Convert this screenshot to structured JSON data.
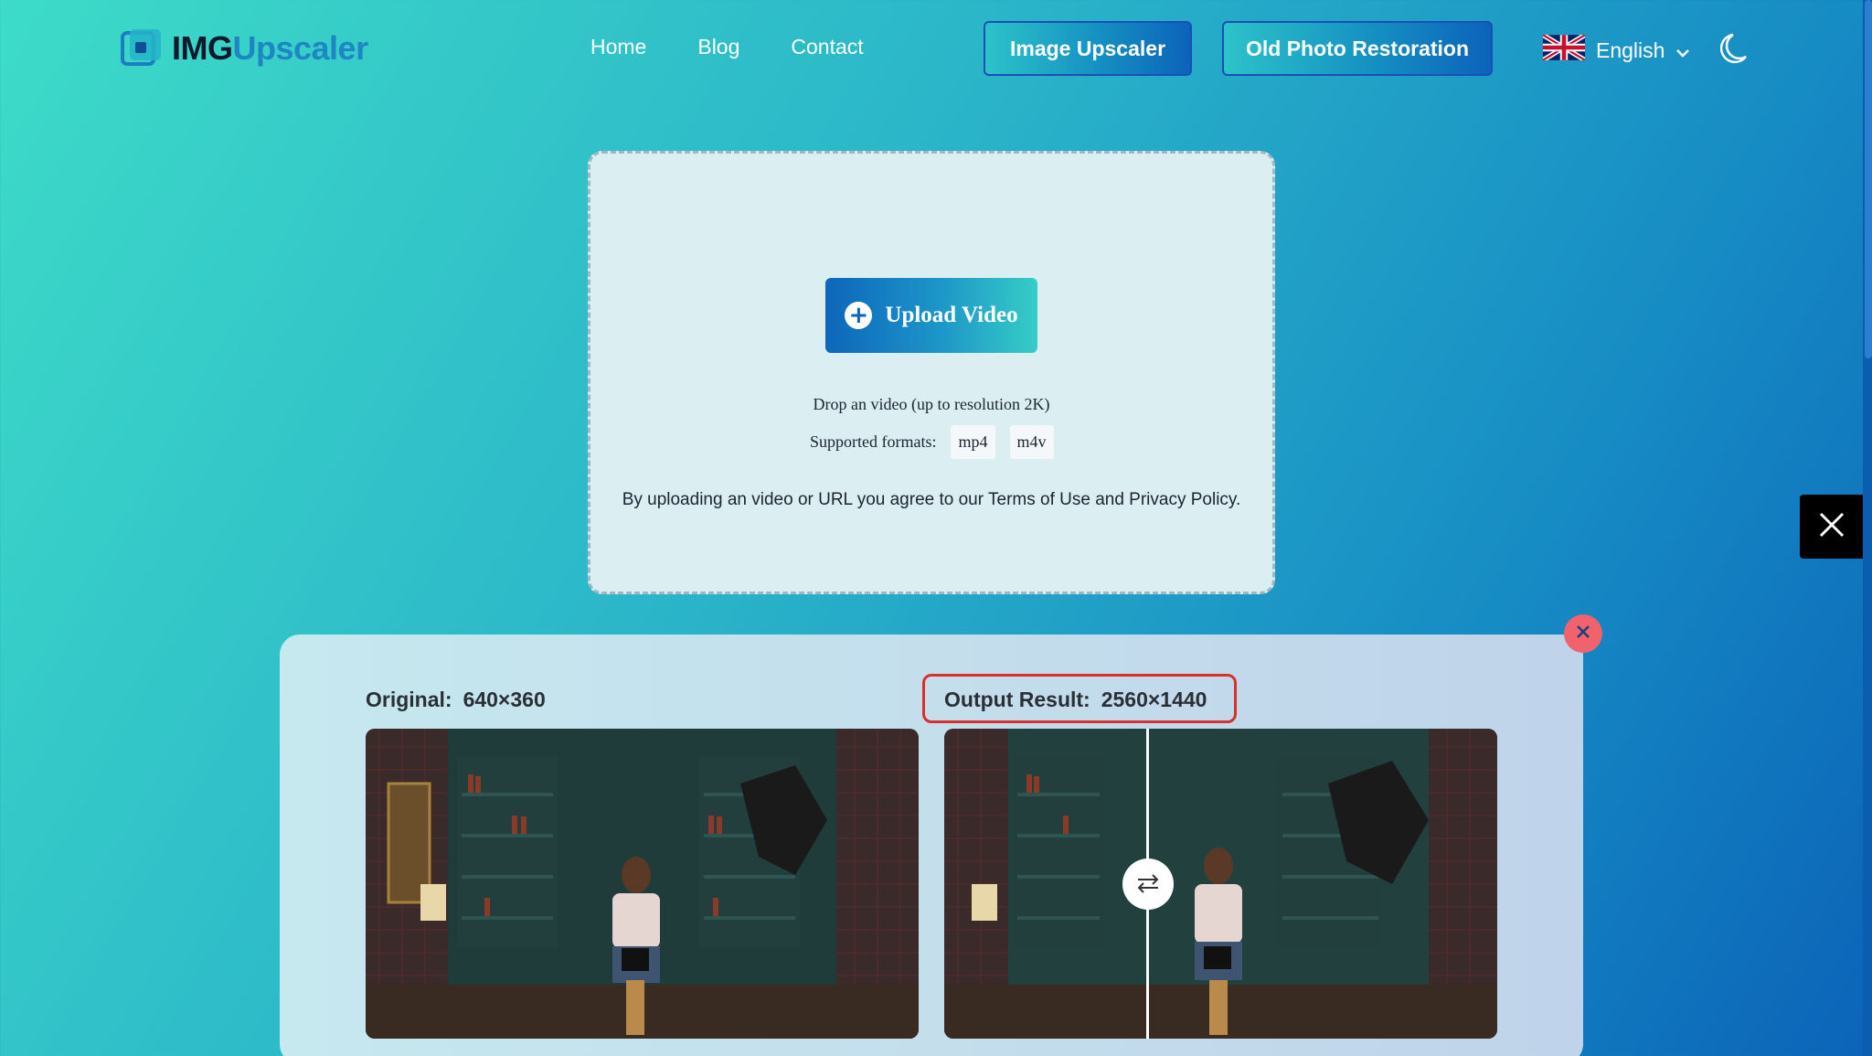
{
  "header": {
    "logo_part1": "IMG",
    "logo_part2": "Upscaler",
    "nav": [
      "Home",
      "Blog",
      "Contact"
    ],
    "btn_image_upscaler": "Image Upscaler",
    "btn_old_photo": "Old Photo Restoration",
    "language": "English"
  },
  "upload": {
    "button_label": "Upload Video",
    "drop_text": "Drop an video (up to resolution 2K)",
    "formats_label": "Supported formats:",
    "formats": [
      "mp4",
      "m4v"
    ],
    "terms": "By uploading an video or URL you agree to our Terms of Use and Privacy Policy."
  },
  "result": {
    "original_label": "Original:",
    "original_res": "640×360",
    "output_label": "Output Result:",
    "output_res": "2560×1440"
  },
  "icons": {
    "logo": "logo-icon",
    "flag": "uk-flag-icon",
    "chevron": "chevron-down-icon",
    "moon": "moon-icon",
    "plus": "plus-circle-icon",
    "social": "x-icon",
    "close": "close-icon",
    "compare": "swap-arrows-icon"
  },
  "colors": {
    "accent": "#0d66bb",
    "close": "#f0626c",
    "highlight_box": "#d9302b"
  }
}
